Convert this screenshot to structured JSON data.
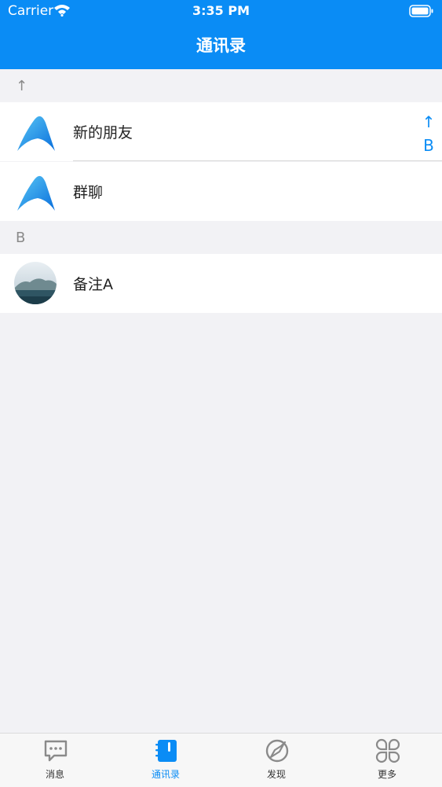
{
  "status_bar": {
    "carrier": "Carrier",
    "time": "3:35 PM"
  },
  "nav": {
    "title": "通讯录"
  },
  "sections": [
    {
      "header": "↑",
      "items": [
        {
          "label": "新的朋友",
          "icon": "app-logo-icon"
        },
        {
          "label": "群聊",
          "icon": "app-logo-icon"
        }
      ]
    },
    {
      "header": "B",
      "items": [
        {
          "label": "备注A",
          "icon": "landscape-avatar"
        }
      ]
    }
  ],
  "index_bar": [
    "↑",
    "B"
  ],
  "tabbar": {
    "items": [
      {
        "label": "消息",
        "icon": "message-bubble-icon",
        "active": false
      },
      {
        "label": "通讯录",
        "icon": "contacts-book-icon",
        "active": true
      },
      {
        "label": "发现",
        "icon": "compass-icon",
        "active": false
      },
      {
        "label": "更多",
        "icon": "grid-more-icon",
        "active": false
      }
    ]
  },
  "colors": {
    "accent": "#0a8cf5",
    "background": "#f2f2f5",
    "tab_inactive": "#333333"
  }
}
